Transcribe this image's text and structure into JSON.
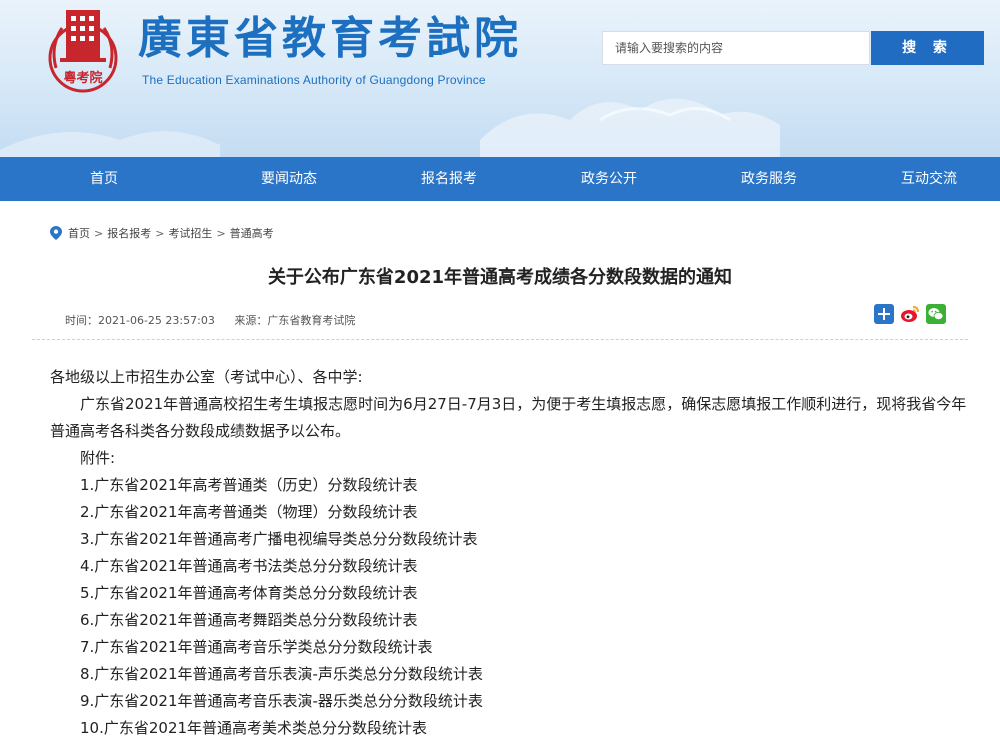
{
  "header": {
    "site_title": "廣東省教育考試院",
    "site_subtitle": "The Education Examinations Authority of Guangdong Province",
    "seal_text": "粵考院",
    "search_placeholder": "请输入要搜索的内容",
    "search_button": "搜 索"
  },
  "nav": {
    "items": [
      {
        "label": "首页"
      },
      {
        "label": "要闻动态"
      },
      {
        "label": "报名报考"
      },
      {
        "label": "政务公开"
      },
      {
        "label": "政务服务"
      },
      {
        "label": "互动交流"
      }
    ]
  },
  "breadcrumb": {
    "items": [
      "首页",
      "报名报考",
      "考试招生",
      "普通高考"
    ],
    "separator": ">"
  },
  "article": {
    "title": "关于公布广东省2021年普通高考成绩各分数段数据的通知",
    "time": "时间：2021-06-25 23:57:03",
    "source": "来源：广东省教育考试院",
    "greeting": "各地级以上市招生办公室（考试中心）、各中学:",
    "paragraph": "广东省2021年普通高校招生考生填报志愿时间为6月27日-7月3日，为便于考生填报志愿，确保志愿填报工作顺利进行，现将我省今年普通高考各科类各分数段成绩数据予以公布。",
    "attachments_label": "附件:",
    "attachments": [
      "1.广东省2021年高考普通类（历史）分数段统计表",
      "2.广东省2021年高考普通类（物理）分数段统计表",
      "3.广东省2021年普通高考广播电视编导类总分分数段统计表",
      "4.广东省2021年普通高考书法类总分分数段统计表",
      "5.广东省2021年普通高考体育类总分分数段统计表",
      "6.广东省2021年普通高考舞蹈类总分分数段统计表",
      "7.广东省2021年普通高考音乐学类总分分数段统计表",
      "8.广东省2021年普通高考音乐表演-声乐类总分分数段统计表",
      "9.广东省2021年普通高考音乐表演-器乐类总分分数段统计表",
      "10.广东省2021年普通高考美术类总分分数段统计表"
    ]
  },
  "share": {
    "icons": [
      "plus-share-icon",
      "weibo-icon",
      "wechat-icon"
    ]
  },
  "colors": {
    "brand_blue": "#1d6fc0",
    "nav_blue": "#2a75c7",
    "seal_red": "#c8262d"
  }
}
